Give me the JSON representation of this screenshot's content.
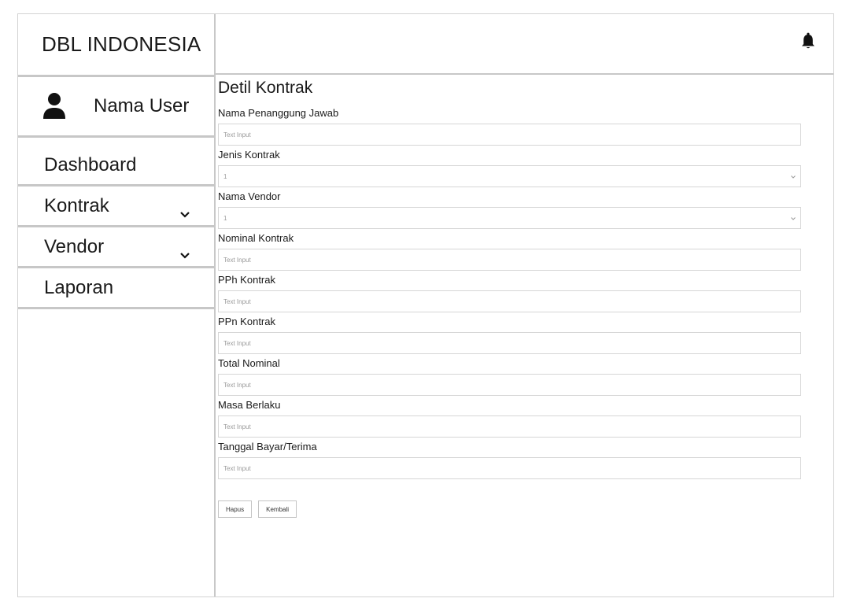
{
  "app": {
    "brand": "DBL INDONESIA"
  },
  "user": {
    "name": "Nama User",
    "icon": "user-icon"
  },
  "nav": {
    "items": [
      {
        "label": "Dashboard",
        "has_submenu": false
      },
      {
        "label": "Kontrak",
        "has_submenu": true
      },
      {
        "label": "Vendor",
        "has_submenu": true
      },
      {
        "label": "Laporan",
        "has_submenu": false
      }
    ]
  },
  "topbar": {
    "icon": "bell-icon"
  },
  "main": {
    "title": "Detil Kontrak",
    "fields": {
      "penanggung_jawab": {
        "label": "Nama Penanggung Jawab",
        "placeholder": "Text Input"
      },
      "jenis_kontrak": {
        "label": "Jenis Kontrak",
        "value": "1"
      },
      "nama_vendor": {
        "label": "Nama Vendor",
        "value": "1"
      },
      "nominal_kontrak": {
        "label": "Nominal Kontrak",
        "placeholder": "Text Input"
      },
      "pph_kontrak": {
        "label": "PPh Kontrak",
        "placeholder": "Text Input"
      },
      "ppn_kontrak": {
        "label": "PPn Kontrak",
        "placeholder": "Text Input"
      },
      "total_nominal": {
        "label": "Total Nominal",
        "placeholder": "Text Input"
      },
      "masa_berlaku": {
        "label": "Masa Berlaku",
        "placeholder": "Text Input"
      },
      "tanggal_bayar": {
        "label": "Tanggal Bayar/Terima",
        "placeholder": "Text Input"
      }
    },
    "buttons": {
      "hapus": "Hapus",
      "kembali": "Kembali"
    }
  },
  "colors": {
    "border": "#c7c7c7",
    "input_border": "#d6d6d6",
    "placeholder": "#9a9a9a"
  }
}
